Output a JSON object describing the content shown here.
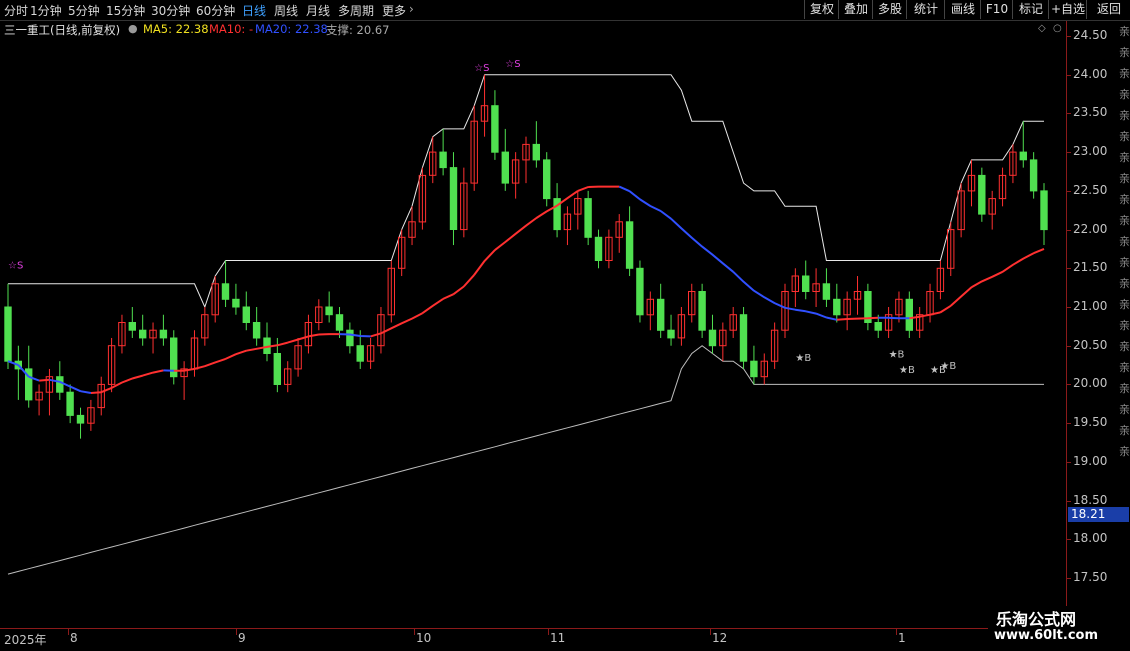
{
  "toolbar": {
    "periods": [
      "分时",
      "1分钟",
      "5分钟",
      "15分钟",
      "30分钟",
      "60分钟",
      "日线",
      "周线",
      "月线",
      "多周期",
      "更多"
    ],
    "active_period": "日线",
    "right_buttons": [
      "复权",
      "叠加",
      "多股",
      "统计",
      "画线",
      "F10",
      "标记",
      "+自选",
      "返回"
    ]
  },
  "info": {
    "stock_name": "三一重工(日线,前复权)",
    "ma5_label": "MA5: 22.38",
    "ma10_label": "MA10: -",
    "ma20_label": "MA20: 22.38",
    "support_label": "支撑: 20.67"
  },
  "colors": {
    "ma5": "#f0e020",
    "ma10": "#ff3030",
    "ma20": "#3050ff",
    "support": "#c8c8c8",
    "up_candle": "#ff3030",
    "down_candle": "#50e050",
    "sell_signal": "#e040e0",
    "buy_signal": "#c0c0c0"
  },
  "y_axis": {
    "ticks": [
      "24.50",
      "24.00",
      "23.50",
      "23.00",
      "22.50",
      "22.00",
      "21.50",
      "21.00",
      "20.50",
      "20.00",
      "19.50",
      "19.00",
      "18.50",
      "18.00",
      "17.50"
    ],
    "current_price": "18.21"
  },
  "x_axis": {
    "labels": [
      "2025年",
      "8",
      "9",
      "10",
      "11",
      "12",
      "1"
    ]
  },
  "signals": {
    "sell_text": "☆S",
    "buy_text": "★B"
  },
  "watermark": {
    "line1": "乐淘公式网",
    "line2": "www.60lt.com"
  },
  "chart_data": {
    "type": "candlestick",
    "title": "三一重工(日线,前复权)",
    "ylim": [
      17.3,
      24.7
    ],
    "x_months": [
      "2025年",
      "8",
      "9",
      "10",
      "11",
      "12",
      "1"
    ],
    "candles": [
      [
        21.0,
        21.3,
        20.2,
        20.3
      ],
      [
        20.3,
        20.5,
        19.8,
        20.2
      ],
      [
        20.2,
        20.5,
        19.7,
        19.8
      ],
      [
        19.8,
        20.0,
        19.6,
        19.9
      ],
      [
        19.9,
        20.2,
        19.6,
        20.1
      ],
      [
        20.1,
        20.3,
        19.8,
        19.9
      ],
      [
        19.9,
        20.0,
        19.5,
        19.6
      ],
      [
        19.6,
        19.7,
        19.3,
        19.5
      ],
      [
        19.5,
        19.8,
        19.4,
        19.7
      ],
      [
        19.7,
        20.1,
        19.6,
        20.0
      ],
      [
        20.0,
        20.6,
        19.9,
        20.5
      ],
      [
        20.5,
        20.9,
        20.4,
        20.8
      ],
      [
        20.8,
        21.0,
        20.6,
        20.7
      ],
      [
        20.7,
        20.9,
        20.5,
        20.6
      ],
      [
        20.6,
        20.8,
        20.4,
        20.7
      ],
      [
        20.7,
        20.9,
        20.5,
        20.6
      ],
      [
        20.6,
        20.7,
        20.0,
        20.1
      ],
      [
        20.1,
        20.3,
        19.8,
        20.2
      ],
      [
        20.2,
        20.7,
        20.1,
        20.6
      ],
      [
        20.6,
        21.0,
        20.5,
        20.9
      ],
      [
        20.9,
        21.4,
        20.8,
        21.3
      ],
      [
        21.3,
        21.6,
        21.0,
        21.1
      ],
      [
        21.1,
        21.3,
        20.9,
        21.0
      ],
      [
        21.0,
        21.2,
        20.7,
        20.8
      ],
      [
        20.8,
        21.0,
        20.5,
        20.6
      ],
      [
        20.6,
        20.8,
        20.3,
        20.4
      ],
      [
        20.4,
        20.6,
        19.9,
        20.0
      ],
      [
        20.0,
        20.3,
        19.9,
        20.2
      ],
      [
        20.2,
        20.6,
        20.1,
        20.5
      ],
      [
        20.5,
        20.9,
        20.4,
        20.8
      ],
      [
        20.8,
        21.1,
        20.7,
        21.0
      ],
      [
        21.0,
        21.2,
        20.8,
        20.9
      ],
      [
        20.9,
        21.0,
        20.6,
        20.7
      ],
      [
        20.7,
        20.8,
        20.4,
        20.5
      ],
      [
        20.5,
        20.7,
        20.2,
        20.3
      ],
      [
        20.3,
        20.6,
        20.2,
        20.5
      ],
      [
        20.5,
        21.0,
        20.4,
        20.9
      ],
      [
        20.9,
        21.6,
        20.8,
        21.5
      ],
      [
        21.5,
        22.0,
        21.4,
        21.9
      ],
      [
        21.9,
        22.3,
        21.8,
        22.1
      ],
      [
        22.1,
        22.8,
        22.0,
        22.7
      ],
      [
        22.7,
        23.2,
        22.6,
        23.0
      ],
      [
        23.0,
        23.3,
        22.7,
        22.8
      ],
      [
        22.8,
        23.0,
        21.8,
        22.0
      ],
      [
        22.0,
        22.8,
        21.9,
        22.6
      ],
      [
        22.6,
        23.6,
        22.5,
        23.4
      ],
      [
        23.4,
        24.0,
        23.2,
        23.6
      ],
      [
        23.6,
        23.8,
        22.9,
        23.0
      ],
      [
        23.0,
        23.3,
        22.5,
        22.6
      ],
      [
        22.6,
        23.0,
        22.4,
        22.9
      ],
      [
        22.9,
        23.2,
        22.6,
        23.1
      ],
      [
        23.1,
        23.4,
        22.8,
        22.9
      ],
      [
        22.9,
        23.0,
        22.3,
        22.4
      ],
      [
        22.4,
        22.6,
        21.9,
        22.0
      ],
      [
        22.0,
        22.3,
        21.8,
        22.2
      ],
      [
        22.2,
        22.5,
        22.0,
        22.4
      ],
      [
        22.4,
        22.5,
        21.8,
        21.9
      ],
      [
        21.9,
        22.0,
        21.5,
        21.6
      ],
      [
        21.6,
        22.0,
        21.5,
        21.9
      ],
      [
        21.9,
        22.2,
        21.7,
        22.1
      ],
      [
        22.1,
        22.3,
        21.4,
        21.5
      ],
      [
        21.5,
        21.6,
        20.8,
        20.9
      ],
      [
        20.9,
        21.2,
        20.7,
        21.1
      ],
      [
        21.1,
        21.3,
        20.6,
        20.7
      ],
      [
        20.7,
        20.9,
        20.5,
        20.6
      ],
      [
        20.6,
        21.0,
        20.5,
        20.9
      ],
      [
        20.9,
        21.3,
        20.8,
        21.2
      ],
      [
        21.2,
        21.3,
        20.6,
        20.7
      ],
      [
        20.7,
        20.9,
        20.4,
        20.5
      ],
      [
        20.5,
        20.8,
        20.3,
        20.7
      ],
      [
        20.7,
        21.0,
        20.6,
        20.9
      ],
      [
        20.9,
        21.0,
        20.2,
        20.3
      ],
      [
        20.3,
        20.5,
        20.0,
        20.1
      ],
      [
        20.1,
        20.4,
        20.0,
        20.3
      ],
      [
        20.3,
        20.8,
        20.2,
        20.7
      ],
      [
        20.7,
        21.3,
        20.6,
        21.2
      ],
      [
        21.2,
        21.5,
        21.0,
        21.4
      ],
      [
        21.4,
        21.6,
        21.1,
        21.2
      ],
      [
        21.2,
        21.5,
        21.0,
        21.3
      ],
      [
        21.3,
        21.5,
        21.0,
        21.1
      ],
      [
        21.1,
        21.3,
        20.8,
        20.9
      ],
      [
        20.9,
        21.2,
        20.7,
        21.1
      ],
      [
        21.1,
        21.4,
        20.9,
        21.2
      ],
      [
        21.2,
        21.3,
        20.7,
        20.8
      ],
      [
        20.8,
        20.9,
        20.6,
        20.7
      ],
      [
        20.7,
        21.0,
        20.6,
        20.9
      ],
      [
        20.9,
        21.2,
        20.8,
        21.1
      ],
      [
        21.1,
        21.2,
        20.6,
        20.7
      ],
      [
        20.7,
        21.0,
        20.6,
        20.9
      ],
      [
        20.9,
        21.3,
        20.8,
        21.2
      ],
      [
        21.2,
        21.6,
        21.1,
        21.5
      ],
      [
        21.5,
        22.1,
        21.4,
        22.0
      ],
      [
        22.0,
        22.6,
        21.9,
        22.5
      ],
      [
        22.5,
        22.9,
        22.3,
        22.7
      ],
      [
        22.7,
        22.8,
        22.1,
        22.2
      ],
      [
        22.2,
        22.5,
        22.0,
        22.4
      ],
      [
        22.4,
        22.8,
        22.3,
        22.7
      ],
      [
        22.7,
        23.1,
        22.6,
        23.0
      ],
      [
        23.0,
        23.4,
        22.8,
        22.9
      ],
      [
        22.9,
        23.0,
        22.4,
        22.5
      ],
      [
        22.5,
        22.6,
        21.8,
        22.0
      ]
    ],
    "support_line_end": 20.67,
    "ma20_end": 22.38
  }
}
